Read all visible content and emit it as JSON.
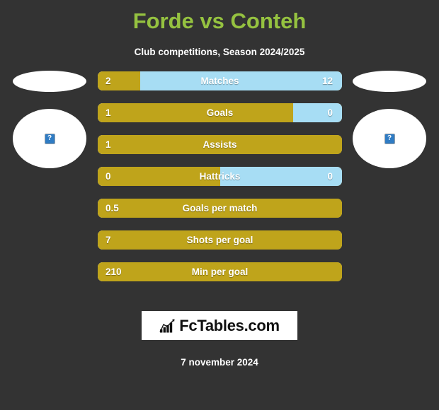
{
  "header": {
    "title": "Forde vs Conteh",
    "subtitle": "Club competitions, Season 2024/2025",
    "title_color": "#95c240"
  },
  "players": {
    "left": {
      "name": "",
      "avatar_icon": "broken-image-icon"
    },
    "right": {
      "name": "",
      "avatar_icon": "broken-image-icon"
    }
  },
  "colors": {
    "background": "#333333",
    "left_bar": "#bfa41b",
    "right_bar": "#a7ddf4",
    "title_green": "#95c240",
    "text": "#ffffff"
  },
  "chart_data": {
    "type": "bar",
    "title": "Forde vs Conteh",
    "subtitle": "Club competitions, Season 2024/2025",
    "orientation": "horizontal-diverging",
    "legend": [
      "Forde",
      "Conteh"
    ],
    "categories": [
      "Matches",
      "Goals",
      "Assists",
      "Hattricks",
      "Goals per match",
      "Shots per goal",
      "Min per goal"
    ],
    "series": [
      {
        "name": "Forde",
        "values": [
          2,
          1,
          1,
          0,
          0.5,
          7,
          210
        ]
      },
      {
        "name": "Conteh",
        "values": [
          12,
          0,
          null,
          0,
          null,
          null,
          null
        ]
      }
    ],
    "rows": [
      {
        "label": "Matches",
        "left_value": "2",
        "right_value": "12",
        "left_pct": 17.5,
        "right_pct": 82.5
      },
      {
        "label": "Goals",
        "left_value": "1",
        "right_value": "0",
        "left_pct": 80,
        "right_pct": 20
      },
      {
        "label": "Assists",
        "left_value": "1",
        "right_value": "",
        "left_pct": 100,
        "right_pct": 0
      },
      {
        "label": "Hattricks",
        "left_value": "0",
        "right_value": "0",
        "left_pct": 50,
        "right_pct": 50
      },
      {
        "label": "Goals per match",
        "left_value": "0.5",
        "right_value": "",
        "left_pct": 100,
        "right_pct": 0
      },
      {
        "label": "Shots per goal",
        "left_value": "7",
        "right_value": "",
        "left_pct": 100,
        "right_pct": 0
      },
      {
        "label": "Min per goal",
        "left_value": "210",
        "right_value": "",
        "left_pct": 100,
        "right_pct": 0
      }
    ]
  },
  "footer": {
    "brand_text": "FcTables.com",
    "brand_icon": "bar-chart-icon",
    "date": "7 november 2024"
  }
}
